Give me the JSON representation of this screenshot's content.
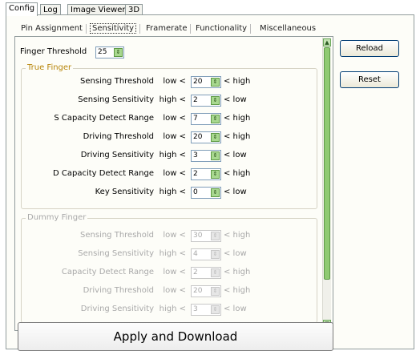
{
  "outer_tabs": [
    {
      "label": "Config",
      "active": true
    },
    {
      "label": "Log",
      "active": false
    },
    {
      "label": "Image Viewer",
      "active": false
    },
    {
      "label": "3D",
      "active": false
    }
  ],
  "inner_tabs": [
    {
      "label": "Pin Assignment",
      "active": false
    },
    {
      "label": "Sensitivity",
      "active": true
    },
    {
      "label": "Framerate",
      "active": false
    },
    {
      "label": "Functionality",
      "active": false
    },
    {
      "label": "Miscellaneous",
      "active": false
    }
  ],
  "finger_threshold": {
    "label": "Finger Threshold",
    "value": "25"
  },
  "true_finger": {
    "title": "True Finger",
    "rows": [
      {
        "label": "Sensing Threshold",
        "left": "low  <",
        "value": "20",
        "right": "< high"
      },
      {
        "label": "Sensing Sensitivity",
        "left": "high <",
        "value": "2",
        "right": "< low"
      },
      {
        "label": "S Capacity Detect Range",
        "left": "low  <",
        "value": "7",
        "right": "< high"
      },
      {
        "label": "Driving Threshold",
        "left": "low  <",
        "value": "20",
        "right": "< high"
      },
      {
        "label": "Driving Sensitivity",
        "left": "high <",
        "value": "3",
        "right": "< low"
      },
      {
        "label": "D Capacity Detect Range",
        "left": "low  <",
        "value": "2",
        "right": "< high"
      },
      {
        "label": "Key Sensitivity",
        "left": "high <",
        "value": "0",
        "right": "< low"
      }
    ]
  },
  "dummy_finger": {
    "title": "Dummy Finger",
    "rows": [
      {
        "label": "Sensing Threshold",
        "left": "low  <",
        "value": "30",
        "right": "< high"
      },
      {
        "label": "Sensing Sensitivity",
        "left": "high <",
        "value": "4",
        "right": "< low"
      },
      {
        "label": "Capacity Detect Range",
        "left": "low  <",
        "value": "2",
        "right": "< high"
      },
      {
        "label": "Driving Threshold",
        "left": "low  <",
        "value": "20",
        "right": "< high"
      },
      {
        "label": "Driving Sensitivity",
        "left": "high <",
        "value": "3",
        "right": "< low"
      }
    ]
  },
  "buttons": {
    "reload": "Reload",
    "reset": "Reset",
    "apply": "Apply and Download"
  },
  "icons": {
    "spin": "spin-arrows-icon",
    "scroll_up": "scroll-up-icon",
    "scroll_down": "scroll-down-icon"
  },
  "colors": {
    "accent_green": "#8fca72",
    "group_title": "#b8860b"
  }
}
